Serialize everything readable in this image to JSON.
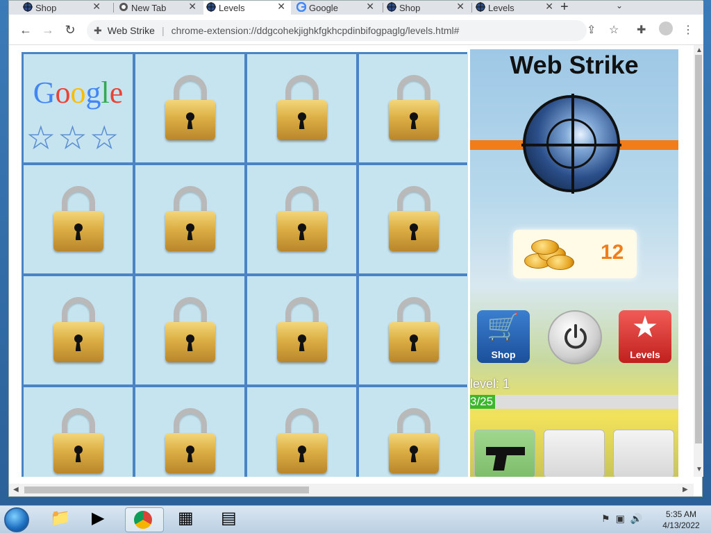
{
  "browser": {
    "tabs": [
      {
        "label": "Shop",
        "icon": "web-strike-icon",
        "active": false
      },
      {
        "label": "New Tab",
        "icon": "chrome-icon",
        "active": false
      },
      {
        "label": "Levels",
        "icon": "web-strike-icon",
        "active": true
      },
      {
        "label": "Google",
        "icon": "google-icon",
        "active": false
      },
      {
        "label": "Shop",
        "icon": "web-strike-icon",
        "active": false
      },
      {
        "label": "Levels",
        "icon": "web-strike-icon",
        "active": false
      }
    ],
    "omnibox": {
      "site_name": "Web Strike",
      "url": "chrome-extension://ddgcohekjighkfgkhcpdinbifogpaglg/levels.html#"
    }
  },
  "levels_grid": {
    "first_level": {
      "logo_text": "Google",
      "stars_count": 3,
      "stars_earned": 0
    },
    "locked_count": 15
  },
  "panel": {
    "title": "Web Strike",
    "coins": "12",
    "shop_label": "Shop",
    "levels_label": "Levels",
    "level_text": "level: 1",
    "progress_text": "3/25",
    "progress_fraction": 0.12
  },
  "taskbar": {
    "time": "5:35 AM",
    "date": "4/13/2022"
  }
}
